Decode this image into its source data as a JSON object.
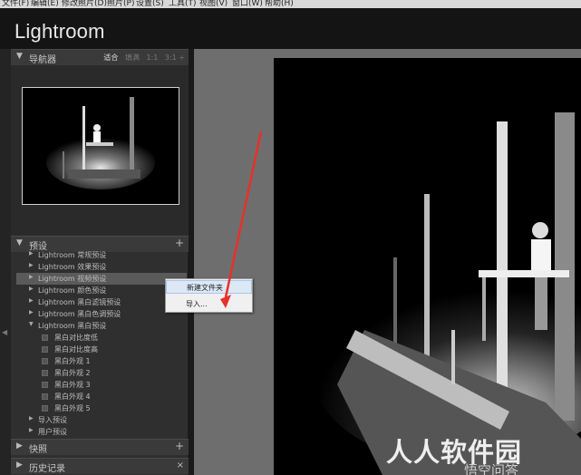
{
  "menubar": {
    "items": [
      "文件(F)",
      "编辑(E)",
      "修改照片(D)",
      "照片(P)",
      "设置(S)",
      "工具(T)",
      "视图(V)",
      "窗口(W)",
      "帮助(H)"
    ]
  },
  "app": {
    "title": "Lightroom"
  },
  "navigator": {
    "title": "导航器",
    "options": [
      "适合",
      "填满",
      "1:1",
      "3:1 ÷"
    ],
    "selected": "适合"
  },
  "presets": {
    "title": "预设",
    "items": [
      {
        "label": "Lightroom 常规预设",
        "type": "folder"
      },
      {
        "label": "Lightroom 效果预设",
        "type": "folder"
      },
      {
        "label": "Lightroom 视频预设",
        "type": "folder",
        "highlighted": true
      },
      {
        "label": "Lightroom 颜色预设",
        "type": "folder"
      },
      {
        "label": "Lightroom 黑白滤镜预设",
        "type": "folder"
      },
      {
        "label": "Lightroom 黑白色调预设",
        "type": "folder"
      },
      {
        "label": "Lightroom 黑白预设",
        "type": "folder-open"
      },
      {
        "label": "黑白对比度低",
        "type": "preset"
      },
      {
        "label": "黑白对比度高",
        "type": "preset"
      },
      {
        "label": "黑白外观 1",
        "type": "preset"
      },
      {
        "label": "黑白外观 2",
        "type": "preset"
      },
      {
        "label": "黑白外观 3",
        "type": "preset"
      },
      {
        "label": "黑白外观 4",
        "type": "preset"
      },
      {
        "label": "黑白外观 5",
        "type": "preset"
      },
      {
        "label": "导入预设",
        "type": "folder"
      },
      {
        "label": "用户预设",
        "type": "folder"
      }
    ]
  },
  "context_menu": {
    "items": [
      "新建文件夹",
      "导入..."
    ],
    "hovered": "新建文件夹"
  },
  "snapshots": {
    "title": "快照"
  },
  "history": {
    "title": "历史记录"
  },
  "watermark": {
    "text": "人人软件园",
    "sub": "悟空问答"
  },
  "colors": {
    "arrow": "#e8302a",
    "panel": "#2f2f2f",
    "center": "#6e6e6e"
  }
}
